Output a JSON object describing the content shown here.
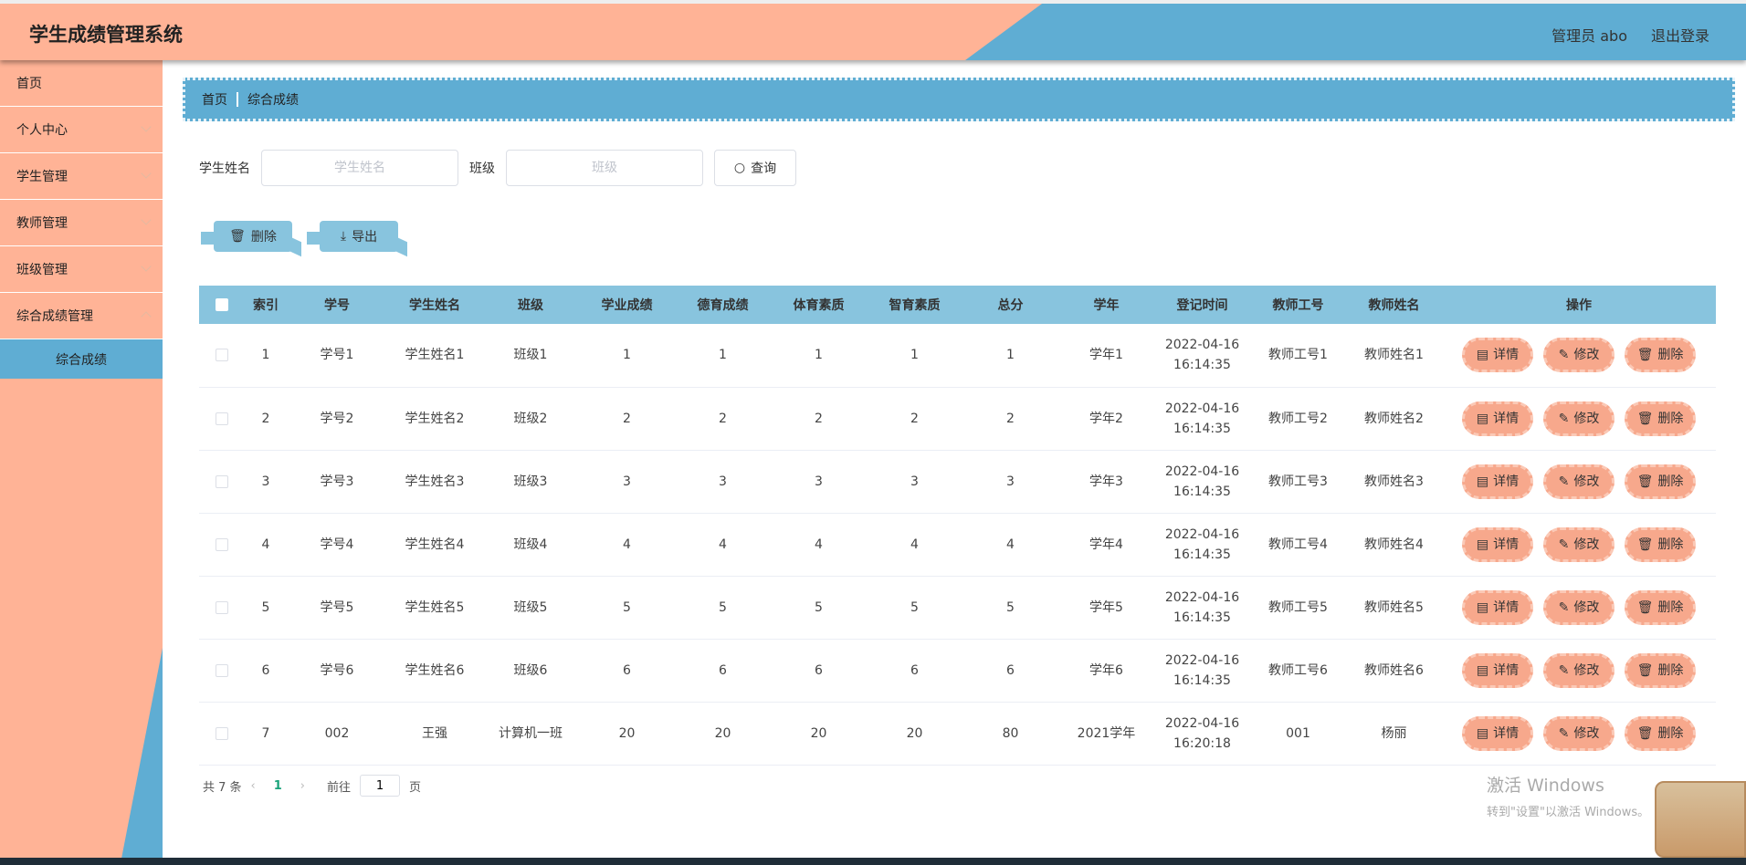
{
  "header": {
    "title": "学生成绩管理系统",
    "user": "管理员 abo",
    "logout": "退出登录"
  },
  "sidebar": {
    "items": [
      {
        "label": "首页"
      },
      {
        "label": "个人中心"
      },
      {
        "label": "学生管理"
      },
      {
        "label": "教师管理"
      },
      {
        "label": "班级管理"
      },
      {
        "label": "综合成绩管理"
      }
    ],
    "active_sub": "综合成绩"
  },
  "breadcrumb": {
    "home": "首页",
    "current": "综合成绩"
  },
  "search": {
    "name_label": "学生姓名",
    "name_placeholder": "学生姓名",
    "name_value": "",
    "class_label": "班级",
    "class_placeholder": "班级",
    "class_value": "",
    "query": "查询"
  },
  "actions": {
    "delete": "删除",
    "export": "导出"
  },
  "table": {
    "columns": [
      "索引",
      "学号",
      "学生姓名",
      "班级",
      "学业成绩",
      "德育成绩",
      "体育素质",
      "智育素质",
      "总分",
      "学年",
      "登记时间",
      "教师工号",
      "教师姓名",
      "操作"
    ],
    "rows": [
      [
        "1",
        "学号1",
        "学生姓名1",
        "班级1",
        "1",
        "1",
        "1",
        "1",
        "1",
        "学年1",
        "2022-04-16 16:14:35",
        "教师工号1",
        "教师姓名1"
      ],
      [
        "2",
        "学号2",
        "学生姓名2",
        "班级2",
        "2",
        "2",
        "2",
        "2",
        "2",
        "学年2",
        "2022-04-16 16:14:35",
        "教师工号2",
        "教师姓名2"
      ],
      [
        "3",
        "学号3",
        "学生姓名3",
        "班级3",
        "3",
        "3",
        "3",
        "3",
        "3",
        "学年3",
        "2022-04-16 16:14:35",
        "教师工号3",
        "教师姓名3"
      ],
      [
        "4",
        "学号4",
        "学生姓名4",
        "班级4",
        "4",
        "4",
        "4",
        "4",
        "4",
        "学年4",
        "2022-04-16 16:14:35",
        "教师工号4",
        "教师姓名4"
      ],
      [
        "5",
        "学号5",
        "学生姓名5",
        "班级5",
        "5",
        "5",
        "5",
        "5",
        "5",
        "学年5",
        "2022-04-16 16:14:35",
        "教师工号5",
        "教师姓名5"
      ],
      [
        "6",
        "学号6",
        "学生姓名6",
        "班级6",
        "6",
        "6",
        "6",
        "6",
        "6",
        "学年6",
        "2022-04-16 16:14:35",
        "教师工号6",
        "教师姓名6"
      ],
      [
        "7",
        "002",
        "王强",
        "计算机一班",
        "20",
        "20",
        "20",
        "20",
        "80",
        "2021学年",
        "2022-04-16 16:20:18",
        "001",
        "杨丽"
      ]
    ],
    "row_actions": {
      "detail": "详情",
      "edit": "修改",
      "delete": "删除"
    }
  },
  "pagination": {
    "total": "共 7 条",
    "current_page": "1",
    "goto_label": "前往",
    "goto_value": "1",
    "page_suffix": "页"
  },
  "watermark": {
    "line1": "激活 Windows",
    "line2": "转到\"设置\"以激活 Windows。"
  },
  "colors": {
    "peach": "#FFB396",
    "blue": "#5FADD3",
    "table_header": "#88C4DE",
    "op_button": "#F7A88C"
  }
}
